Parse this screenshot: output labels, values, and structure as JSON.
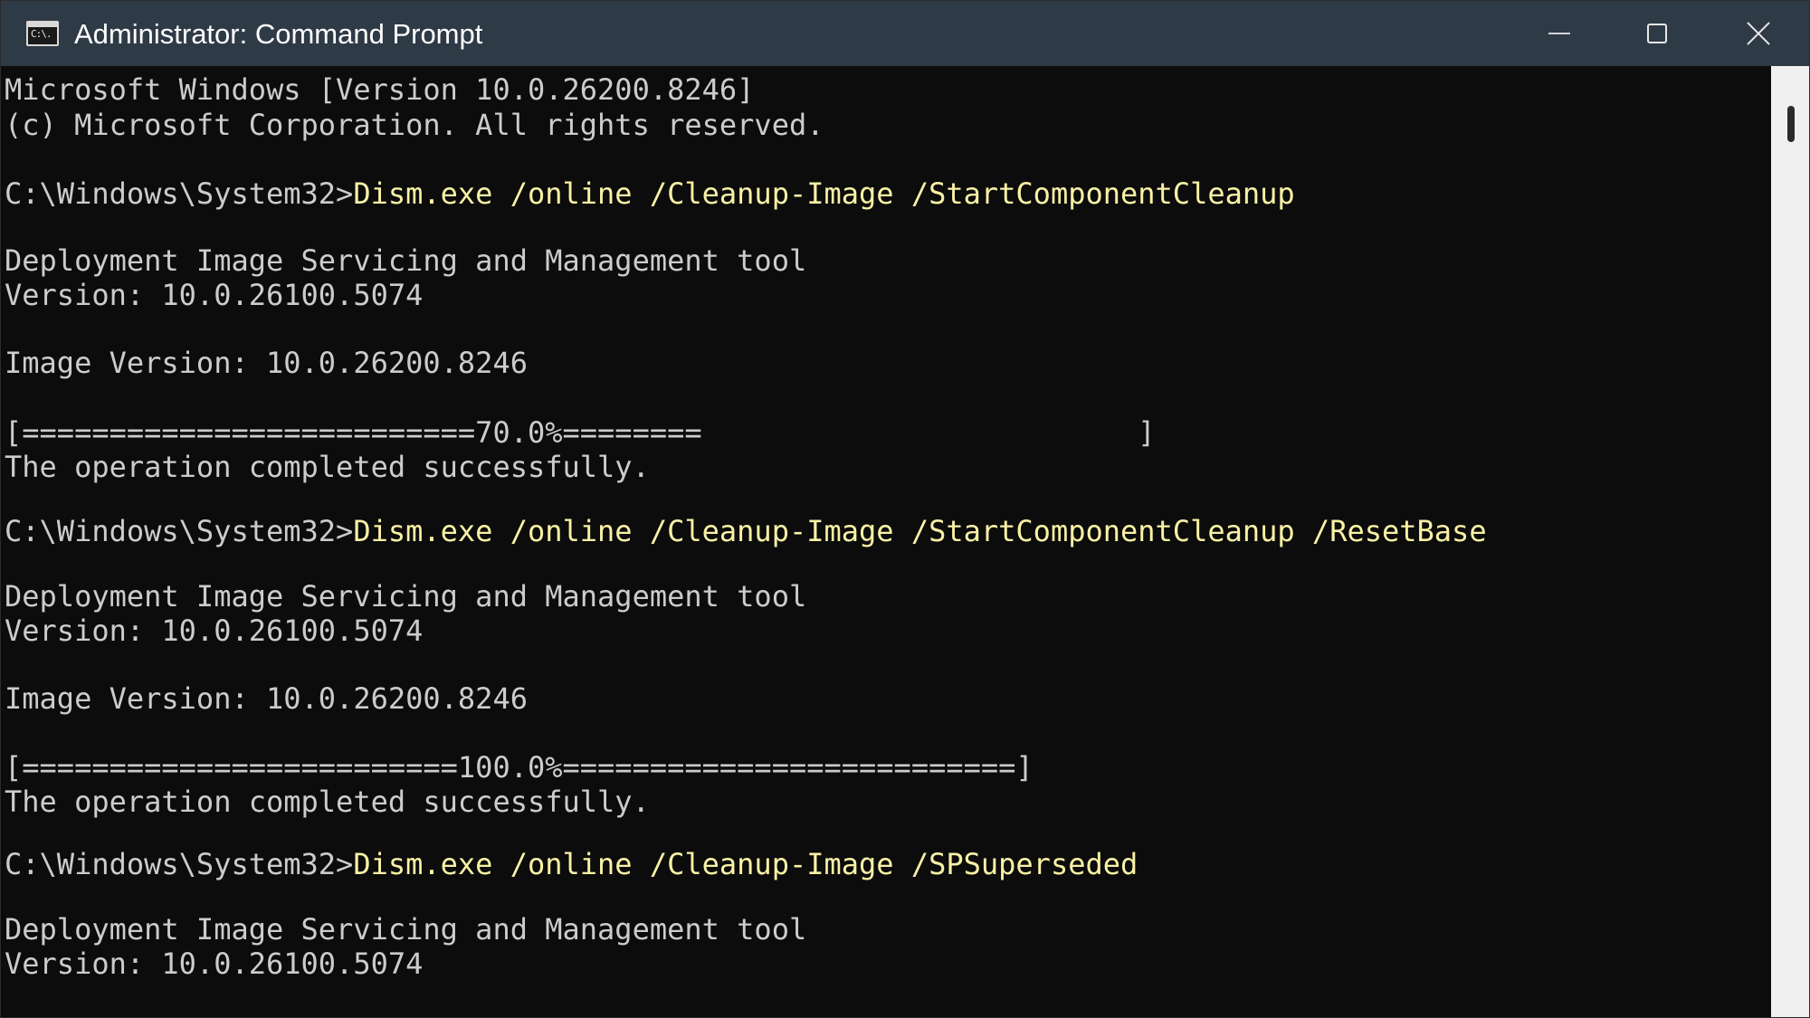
{
  "window": {
    "title": "Administrator: Command Prompt",
    "icon_name": "command-prompt-icon",
    "icon_glyph": "C:\\."
  },
  "controls": {
    "minimize_icon": "minimize-icon",
    "maximize_icon": "maximize-icon",
    "close_icon": "close-icon"
  },
  "colors": {
    "titlebar": "#2f3a47",
    "console_bg": "#0c0c0c",
    "output_text": "#cccccc",
    "command_text": "#f9f1a5"
  },
  "console": {
    "lines": [
      {
        "text": "Microsoft Windows [Version 10.0.26200.8246]"
      },
      {
        "text": "(c) Microsoft Corporation. All rights reserved."
      },
      {
        "prompt": "C:\\Windows\\System32>",
        "cmd": "Dism.exe /online /Cleanup-Image /StartComponentCleanup"
      },
      {
        "text": "Deployment Image Servicing and Management tool"
      },
      {
        "text": "Version: 10.0.26100.5074"
      },
      {
        "text": "Image Version: 10.0.26200.8246"
      },
      {
        "text": "[==========================70.0%========                         ]"
      },
      {
        "text": "The operation completed successfully."
      },
      {
        "prompt": "C:\\Windows\\System32>",
        "cmd": "Dism.exe /online /Cleanup-Image /StartComponentCleanup /ResetBase"
      },
      {
        "text": "Deployment Image Servicing and Management tool"
      },
      {
        "text": "Version: 10.0.26100.5074"
      },
      {
        "text": "Image Version: 10.0.26200.8246"
      },
      {
        "text": "[=========================100.0%==========================]"
      },
      {
        "text": "The operation completed successfully."
      },
      {
        "prompt": "C:\\Windows\\System32>",
        "cmd": "Dism.exe /online /Cleanup-Image /SPSuperseded"
      },
      {
        "text": "Deployment Image Servicing and Management tool"
      },
      {
        "text": "Version: 10.0.26100.5074"
      }
    ]
  }
}
